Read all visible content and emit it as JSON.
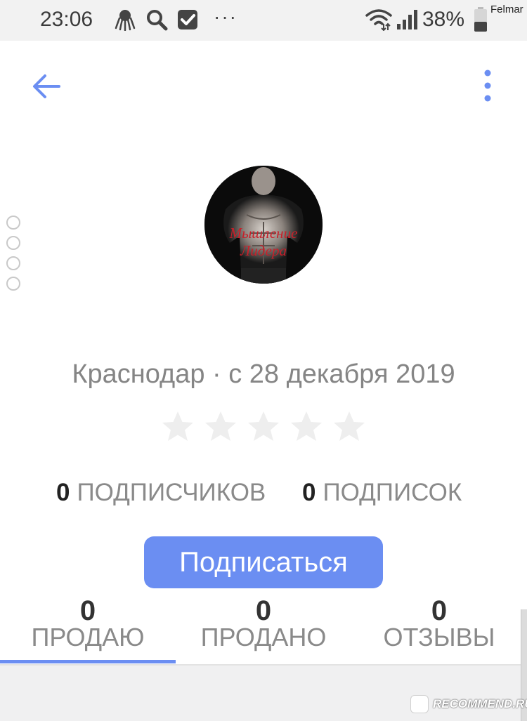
{
  "status_bar": {
    "time": "23:06",
    "more_indicator": "···",
    "battery_percent": "38%",
    "corner_label": "Felmar",
    "icons": [
      "octopus-icon",
      "search-icon",
      "checkbox-icon",
      "wifi-icon",
      "signal-icon",
      "battery-icon"
    ]
  },
  "app_bar": {
    "back_icon": "arrow-left-icon",
    "menu_icon": "more-vertical-icon"
  },
  "profile": {
    "avatar_icon": "profile-avatar",
    "avatar_text_line1": "Мышление",
    "avatar_text_line2": "Лидера",
    "location_since": "Краснодар · с 28 декабря 2019",
    "rating": 0,
    "rating_max": 5
  },
  "counts": {
    "followers_count": "0",
    "followers_label": "ПОДПИСЧИКОВ",
    "following_count": "0",
    "following_label": "ПОДПИСОК"
  },
  "subscribe_button": "Подписаться",
  "tabs": [
    {
      "count": "0",
      "label": "ПРОДАЮ",
      "active": true
    },
    {
      "count": "0",
      "label": "ПРОДАНО",
      "active": false
    },
    {
      "count": "0",
      "label": "ОТЗЫВЫ",
      "active": false
    }
  ],
  "watermark": "RECOMMEND.RU",
  "colors": {
    "accent": "#6b8ef2",
    "muted_text": "#8a8a8a",
    "star_empty": "#eeeeee"
  }
}
